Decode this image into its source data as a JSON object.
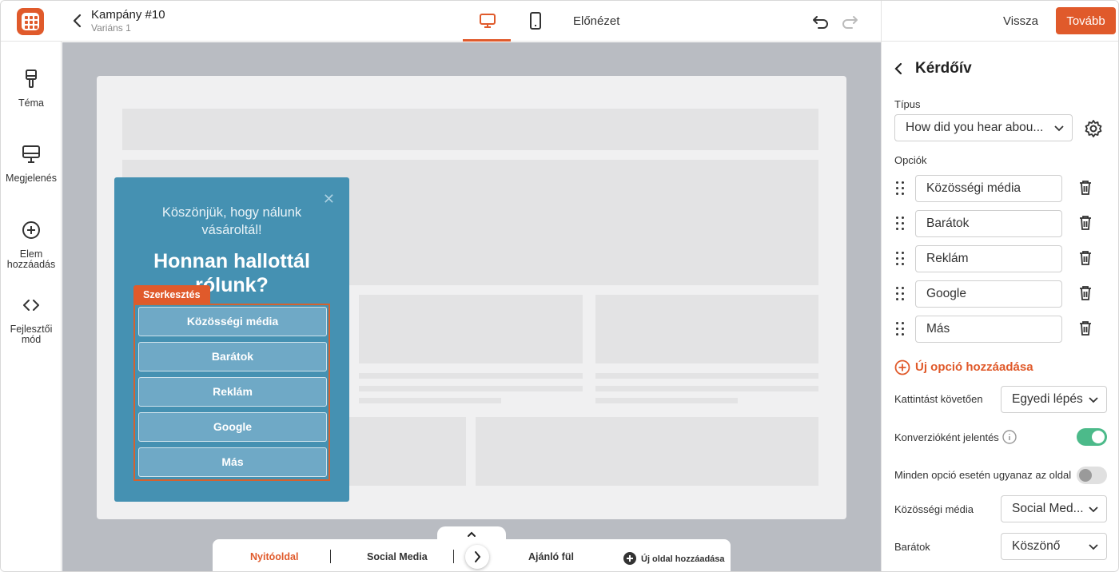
{
  "header": {
    "campaign": "Kampány #10",
    "variant": "Variáns 1",
    "preview": "Előnézet",
    "back": "Vissza",
    "next": "Tovább",
    "accent": "#e05a2b"
  },
  "sidebar": {
    "items": [
      {
        "label": "Téma",
        "icon": "brush-icon"
      },
      {
        "label": "Megjelenés",
        "icon": "monitor-icon"
      },
      {
        "label": "Elem hozzáadás",
        "icon": "plus-circle-icon"
      },
      {
        "label": "Fejlesztői mód",
        "icon": "code-icon"
      }
    ]
  },
  "popup": {
    "thanks": "Köszönjük, hogy nálunk vásároltál!",
    "question": "Honnan hallottál rólunk?",
    "edit_tag": "Szerkesztés",
    "options": [
      "Közösségi média",
      "Barátok",
      "Reklám",
      "Google",
      "Más"
    ],
    "bg_color": "#4591b2"
  },
  "pages": {
    "tabs": [
      "Nyitóoldal",
      "Social Media",
      "Ajánló fül"
    ],
    "active": "Nyitóoldal",
    "add_page": "Új oldal hozzáadása"
  },
  "panel": {
    "title": "Kérdőív",
    "type_label": "Típus",
    "type_value": "How did you hear abou...",
    "options_label": "Opciók",
    "options": [
      "Közösségi média",
      "Barátok",
      "Reklám",
      "Google",
      "Más"
    ],
    "add_option": "Új opció hozzáadása",
    "after_click_label": "Kattintást követően",
    "after_click_value": "Egyedi lépés",
    "conversion_label": "Konverzióként jelentés",
    "conversion_on": true,
    "same_page_label": "Minden opció esetén ugyanaz az oldal",
    "same_page_on": false,
    "mapping": [
      {
        "label": "Közösségi média",
        "value": "Social Med..."
      },
      {
        "label": "Barátok",
        "value": "Köszönő"
      }
    ],
    "toggle_on_color": "#4cba8a"
  }
}
